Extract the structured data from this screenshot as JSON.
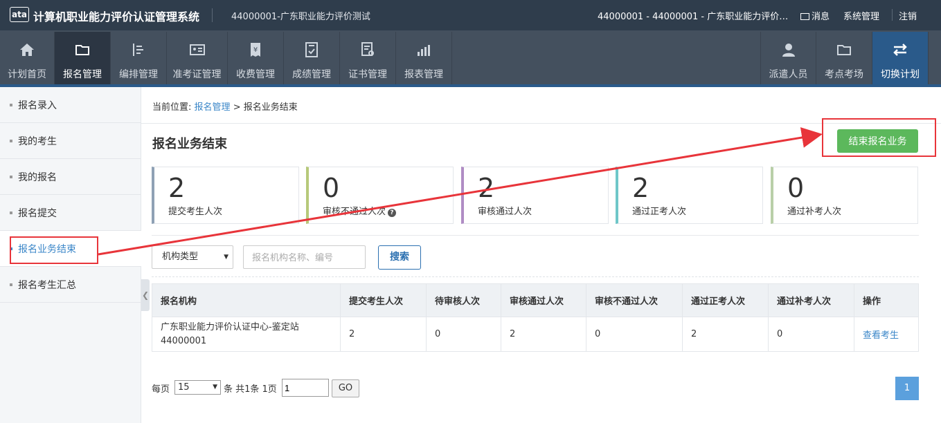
{
  "header": {
    "logo_text": "ata",
    "app_title": "计算机职业能力评价认证管理系统",
    "sub_title": "44000001-广东职业能力评价测试",
    "user_info": "44000001 - 44000001 - 广东职业能力评价…",
    "messages": "消息",
    "system_mgmt": "系统管理",
    "logout": "注销"
  },
  "nav": {
    "items": [
      {
        "label": "计划首页",
        "icon": "home-icon"
      },
      {
        "label": "报名管理",
        "icon": "folder-icon"
      },
      {
        "label": "编排管理",
        "icon": "list-icon"
      },
      {
        "label": "准考证管理",
        "icon": "id-card-icon"
      },
      {
        "label": "收费管理",
        "icon": "yen-receipt-icon"
      },
      {
        "label": "成绩管理",
        "icon": "score-sheet-icon"
      },
      {
        "label": "证书管理",
        "icon": "certificate-icon"
      },
      {
        "label": "报表管理",
        "icon": "chart-icon"
      },
      {
        "label": "派遣人员",
        "icon": "person-icon"
      },
      {
        "label": "考点考场",
        "icon": "folder-icon"
      },
      {
        "label": "切换计划",
        "icon": "switch-arrows-icon"
      }
    ]
  },
  "sidebar": {
    "items": [
      {
        "label": "报名录入"
      },
      {
        "label": "我的考生"
      },
      {
        "label": "我的报名"
      },
      {
        "label": "报名提交"
      },
      {
        "label": "报名业务结束"
      },
      {
        "label": "报名考生汇总"
      }
    ]
  },
  "breadcrumb": {
    "prefix": "当前位置:",
    "link": "报名管理",
    "separator": ">",
    "current": "报名业务结束"
  },
  "page": {
    "title": "报名业务结束",
    "end_button": "结束报名业务"
  },
  "stats": [
    {
      "value": "2",
      "label": "提交考生人次",
      "color": "#8fa1b5"
    },
    {
      "value": "0",
      "label": "审核不通过人次",
      "color": "#b7c97a"
    },
    {
      "value": "2",
      "label": "审核通过人次",
      "color": "#b08cc4"
    },
    {
      "value": "2",
      "label": "通过正考人次",
      "color": "#6fc7c9"
    },
    {
      "value": "0",
      "label": "通过补考人次",
      "color": "#b9cfa8"
    }
  ],
  "filters": {
    "org_type": "机构类型",
    "search_placeholder": "报名机构名称、编号",
    "search_button": "搜索"
  },
  "table": {
    "headers": [
      "报名机构",
      "提交考生人次",
      "待审核人次",
      "审核通过人次",
      "审核不通过人次",
      "通过正考人次",
      "通过补考人次",
      "操作"
    ],
    "rows": [
      {
        "org_name": "广东职业能力评价认证中心-鉴定站",
        "org_code": "44000001",
        "submitted": "2",
        "pending": "0",
        "approved": "2",
        "rejected": "0",
        "passed_main": "2",
        "passed_makeup": "0",
        "action": "查看考生"
      }
    ]
  },
  "pager": {
    "per_page_label": "每页",
    "page_size": "15",
    "summary": "条 共1条 1页",
    "page_input": "1",
    "go": "GO",
    "current_page": "1"
  },
  "colors": {
    "accent": "#3a86c8",
    "success": "#5cb85c",
    "annotation": "#e8343a",
    "header_bg": "#2f3d4c"
  }
}
